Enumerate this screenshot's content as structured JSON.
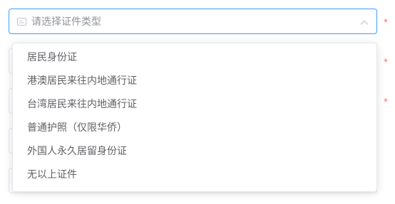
{
  "select": {
    "placeholder": "请选择证件类型",
    "field_icon": "id-card-icon",
    "arrow_icon": "chevron-up-icon",
    "expanded": true
  },
  "required_marks": [
    "*",
    "*",
    "*"
  ],
  "dropdown": {
    "options": [
      "居民身份证",
      "港澳居民来往内地通行证",
      "台湾居民来往内地通行证",
      "普通护照（仅限华侨）",
      "外国人永久居留身份证",
      "无以上证件"
    ]
  },
  "colors": {
    "focus_border": "#409eff",
    "required": "#f56c6c",
    "option_text": "#606266",
    "placeholder_text": "#909399"
  }
}
